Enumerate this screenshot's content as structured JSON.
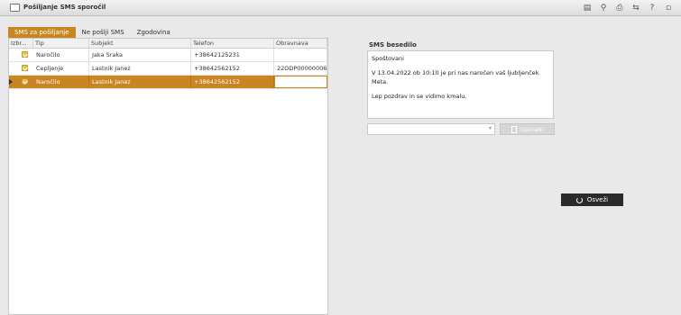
{
  "window": {
    "title": "Pošiljanje SMS sporočil"
  },
  "toolbar_icons": [
    "document-icon",
    "search-icon",
    "print-icon",
    "swap-icon",
    "help-icon",
    "restore-icon"
  ],
  "toolbar_glyphs": [
    "▤",
    "⚲",
    "⎙",
    "⇆",
    "?",
    "▫"
  ],
  "tabs": [
    {
      "label": "SMS za pošiljanje",
      "active": true
    },
    {
      "label": "Ne pošlji SMS",
      "active": false
    },
    {
      "label": "Zgodovina",
      "active": false
    }
  ],
  "table": {
    "columns": [
      "Izbr...",
      "Tip",
      "Subjekt",
      "Telefon",
      "Obravnava"
    ],
    "rows": [
      {
        "checked": true,
        "tip": "Naročilo",
        "subjekt": "Jaka Sraka",
        "telefon": "+38642125231",
        "obravnava": ""
      },
      {
        "checked": true,
        "tip": "Cepljenje",
        "subjekt": "Lastnik Janez",
        "telefon": "+38642562152",
        "obravnava": "22ODP00000006"
      },
      {
        "checked": true,
        "tip": "Naročilo",
        "subjekt": "Lastnik Janez",
        "telefon": "+38642562152",
        "obravnava": "",
        "selected": true
      }
    ]
  },
  "sms": {
    "label": "SMS besedilo",
    "lines": [
      "Spoštovani",
      "V 13.04.2022 ob 10:10 je pri nas naročen vaš ljubljenček Meta.",
      "Lep pozdrav in se vidimo kmalu."
    ],
    "template_value": "",
    "apply_label": "Uporabi"
  },
  "refresh_label": "Osveži",
  "colors": {
    "accent": "#c98521",
    "dark_button": "#2a2a2a"
  }
}
